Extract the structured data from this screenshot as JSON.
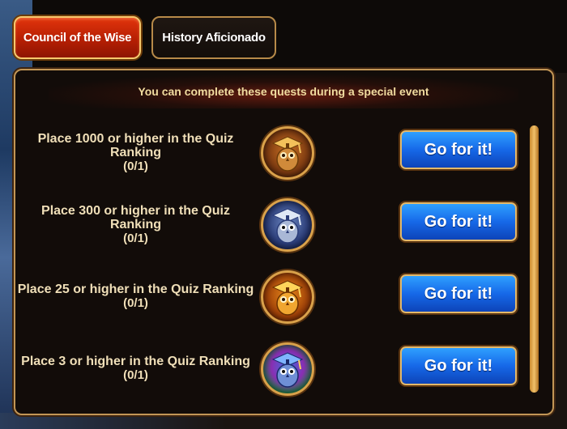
{
  "tabs": [
    {
      "label": "Council of the Wise",
      "active": true
    },
    {
      "label": "History Aficionado",
      "active": false
    }
  ],
  "banner": "You can complete these quests during a special event",
  "quests": [
    {
      "text_line1": "Place 1000 or higher in the Quiz",
      "text_line2": "Ranking",
      "progress": "(0/1)",
      "badge": "bronze-owl-graduate-icon",
      "button": "Go for it!"
    },
    {
      "text_line1": "Place 300 or higher in the Quiz",
      "text_line2": "Ranking",
      "progress": "(0/1)",
      "badge": "silver-owl-graduate-icon",
      "button": "Go for it!"
    },
    {
      "text_line1": "Place 25 or higher in the Quiz Ranking",
      "text_line2": "",
      "progress": "(0/1)",
      "badge": "gold-owl-graduate-icon",
      "button": "Go for it!"
    },
    {
      "text_line1": "Place 3 or higher in the Quiz Ranking",
      "text_line2": "",
      "progress": "(0/1)",
      "badge": "rainbow-owl-graduate-icon",
      "button": "Go for it!"
    }
  ],
  "colors": {
    "active_tab": "#c52606",
    "button": "#1668e8",
    "frame": "#c29656",
    "text": "#f0dfb8"
  }
}
